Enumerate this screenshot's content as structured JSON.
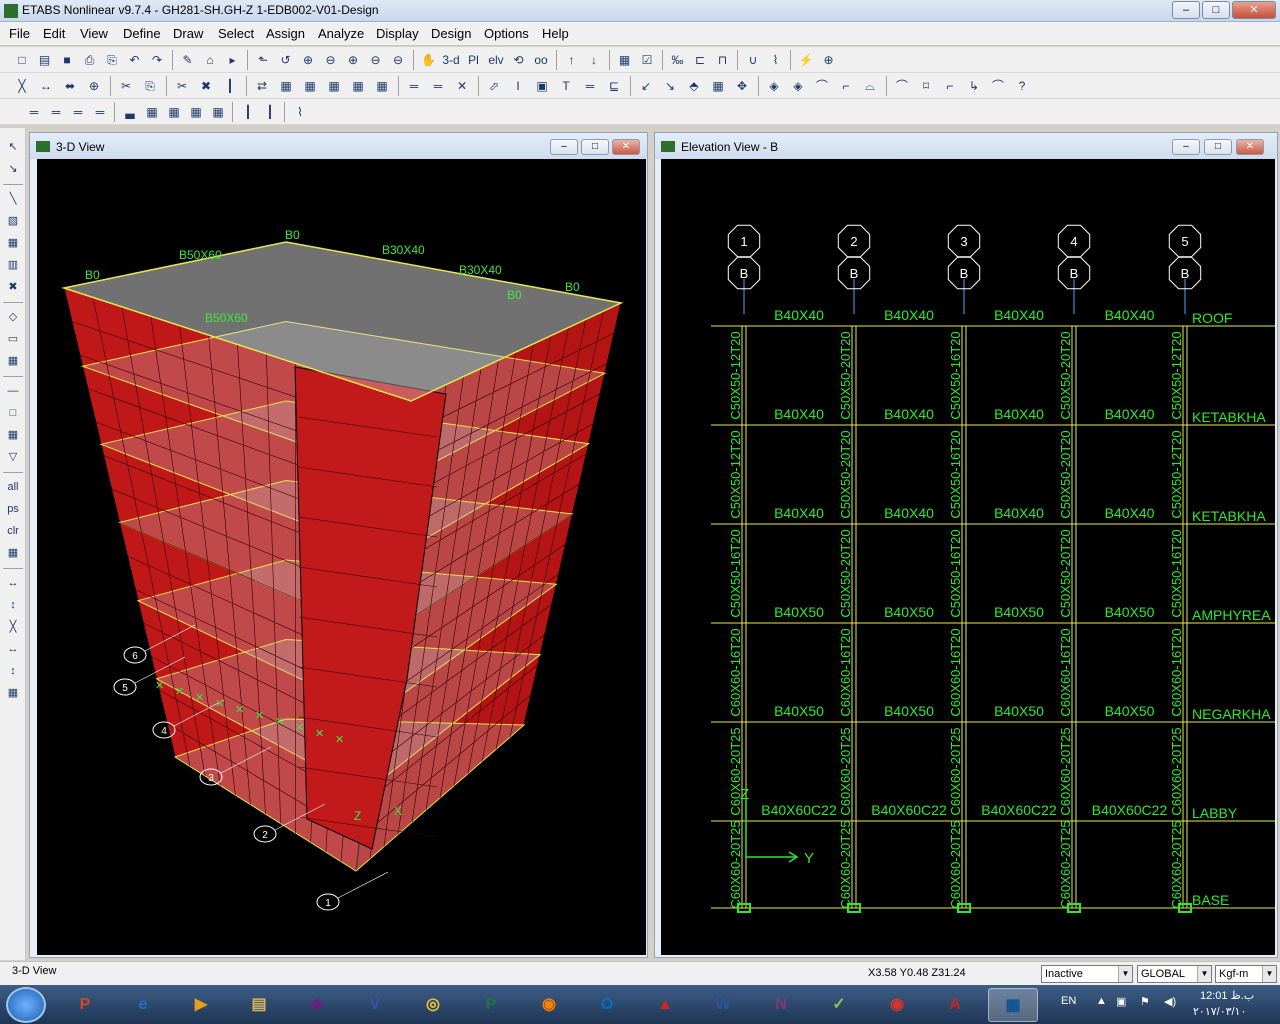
{
  "window": {
    "title": "ETABS Nonlinear v9.7.4 - GH281-SH.GH-Z 1-EDB002-V01-Design",
    "min": "–",
    "max": "□",
    "close": "✕"
  },
  "menu": [
    "File",
    "Edit",
    "View",
    "Define",
    "Draw",
    "Select",
    "Assign",
    "Analyze",
    "Display",
    "Design",
    "Options",
    "Help"
  ],
  "toolbar": {
    "row1": [
      "□",
      "▤",
      "■",
      "⎙",
      "⎘",
      "↶",
      "↷",
      "✎",
      "⌂",
      "▸",
      "⬑",
      "↺",
      "⊕",
      "⊖",
      "⊕",
      "⊖",
      "⊖",
      "✋",
      "3-d",
      "Pl",
      "elv",
      "⟲",
      "oo",
      "↑",
      "↓",
      "▦",
      "☑",
      "‰",
      "⊏",
      "⊓",
      "∪",
      "⌇",
      "⚡",
      "⊕"
    ],
    "row2": [
      "╳",
      "↔",
      "⬌",
      "⊕",
      "✂",
      "⎘",
      "✂",
      "✖",
      "┃",
      "⇄",
      "▦",
      "▦",
      "▦",
      "▦",
      "▦",
      "═",
      "═",
      "✕",
      "⬀",
      "I",
      "▣",
      "T",
      "═",
      "⊑",
      "↙",
      "↘",
      "⬘",
      "▦",
      "✥",
      "◈",
      "◈",
      "⌒",
      "⌐",
      "⌓",
      "⌒",
      "⌑",
      "⌐",
      "↳",
      "⌒",
      "?"
    ],
    "row3": [
      "═",
      "═",
      "═",
      "═",
      "▃",
      "▦",
      "▦",
      "▦",
      "▦",
      "┃",
      "┃",
      "⌇"
    ]
  },
  "left_toolbar": [
    "↖",
    "↘",
    "╲",
    "▧",
    "▦",
    "▥",
    "✖",
    "◇",
    "▭",
    "▦",
    "—",
    "□",
    "▦",
    "▽",
    "all",
    "ps",
    "clr",
    "▦",
    "↔",
    "↕",
    "╳",
    "↔",
    "↕",
    "▦"
  ],
  "view3d": {
    "title": "3-D View",
    "overlay_labels": [
      "B0",
      "B50X60",
      "B30X40",
      "B0",
      "B30X40",
      "B0",
      "B50X60",
      "B0",
      "X",
      "Z"
    ],
    "grid_bubbles": [
      "6",
      "5",
      "4",
      "3",
      "2",
      "1"
    ]
  },
  "elevation": {
    "title": "Elevation View - B",
    "grid_columns": [
      "1",
      "2",
      "3",
      "4",
      "5"
    ],
    "grid_row": "B",
    "stories": [
      "ROOF",
      "KETABKHA",
      "KETABKHA",
      "AMPHYREA",
      "NEGARKHA",
      "LABBY",
      "BASE"
    ],
    "beam_labels": [
      [
        "B40X40",
        "B40X40",
        "B40X40",
        "B40X40"
      ],
      [
        "B40X40",
        "B40X40",
        "B40X40",
        "B40X40"
      ],
      [
        "B40X40",
        "B40X40",
        "B40X40",
        "B40X40"
      ],
      [
        "B40X50",
        "B40X50",
        "B40X50",
        "B40X50"
      ],
      [
        "B40X50",
        "B40X50",
        "B40X50",
        "B40X50"
      ],
      [
        "B40X60C22",
        "B40X60C22",
        "B40X60C22",
        "B40X60C22"
      ]
    ],
    "column_labels": [
      [
        "C50X50-12T20",
        "C50X50-20T20",
        "C50X50-16T20",
        "C50X50-20T20",
        "C50X50-12T20"
      ],
      [
        "C50X50-12T20",
        "C50X50-20T20",
        "C50X50-16T20",
        "C50X50-20T20",
        "C50X50-12T20"
      ],
      [
        "C50X50-16T20",
        "C50X50-20T20",
        "C50X50-16T20",
        "C50X50-20T20",
        "C50X50-16T20"
      ],
      [
        "C60X60-16T20",
        "C60X60-16T20",
        "C60X60-16T20",
        "C60X60-16T20",
        "C60X60-16T20"
      ],
      [
        "C60X60-20T25",
        "C60X60-20T25",
        "C60X60-20T25",
        "C60X60-20T25",
        "C60X60-20T25"
      ],
      [
        "C60X60-20T25",
        "C60X60-20T25",
        "C60X60-20T25",
        "C60X60-20T25",
        "C60X60-20T25"
      ]
    ],
    "axis_y": "Y",
    "axis_z": "Z"
  },
  "status": {
    "view_name": "3-D View",
    "coords": "X3.58  Y0.48  Z31.24",
    "mode": "Inactive",
    "csys": "GLOBAL",
    "units": "Kgf-m"
  },
  "taskbar": {
    "apps": [
      "P",
      "e",
      "▶",
      "▤",
      "◆",
      "V",
      "◎",
      "P",
      "◉",
      "O",
      "▲",
      "W",
      "N",
      "✓",
      "◉",
      "A",
      "▦"
    ],
    "lang": "EN",
    "time": "12:01 ب.ظ",
    "date": "٢٠١٧/٠٣/١٠"
  }
}
